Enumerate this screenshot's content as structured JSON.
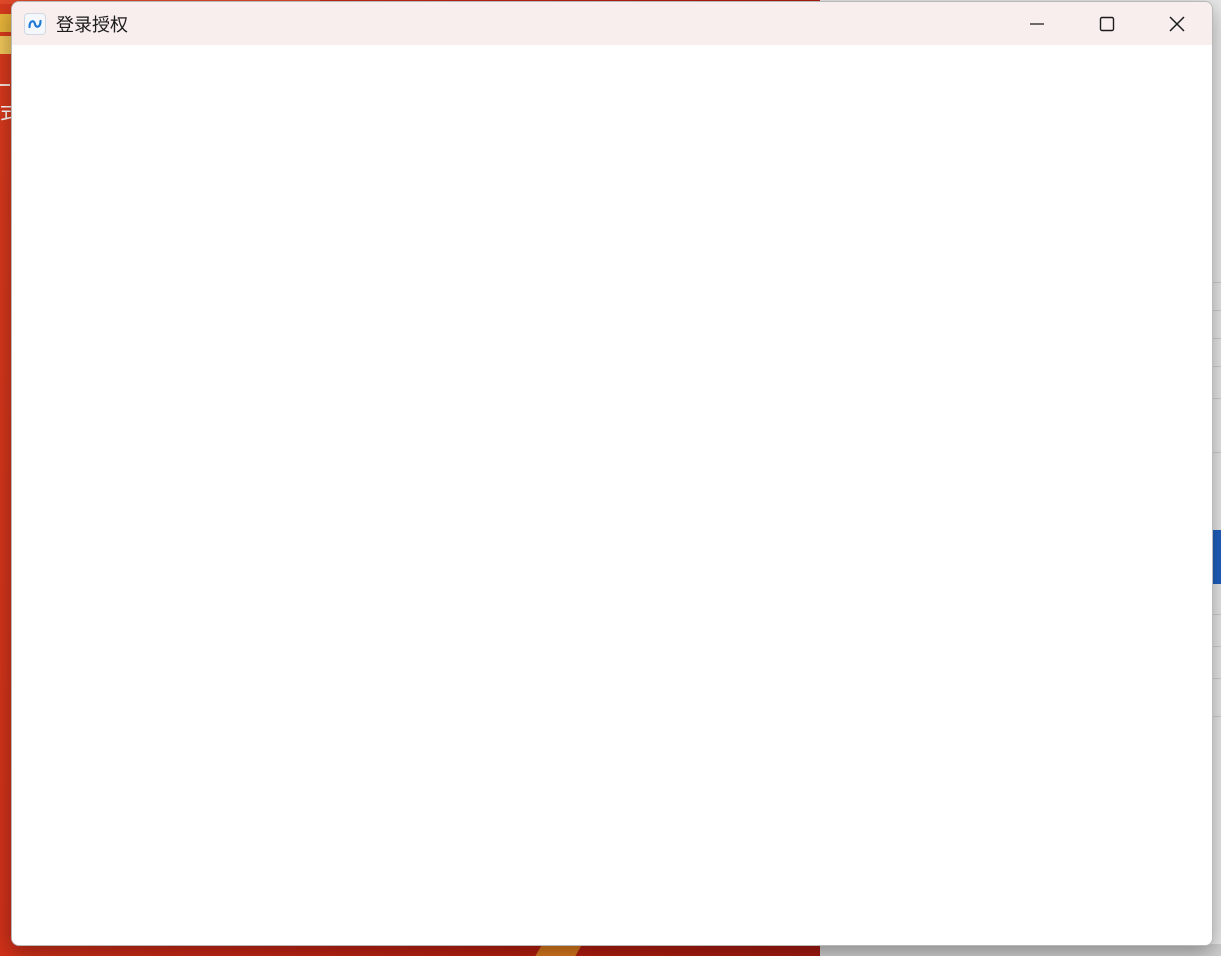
{
  "window": {
    "title": "登录授权",
    "app_icon": "app-logo-icon",
    "controls": {
      "minimize_icon": "minimize-icon",
      "maximize_icon": "maximize-icon",
      "close_icon": "close-icon"
    }
  },
  "background": {
    "partial_text": "式"
  },
  "colors": {
    "titlebar": "#f8eeed",
    "window_bg": "#ffffff",
    "accent_blue": "#1f5fbf",
    "desktop_red": "#c92816"
  }
}
